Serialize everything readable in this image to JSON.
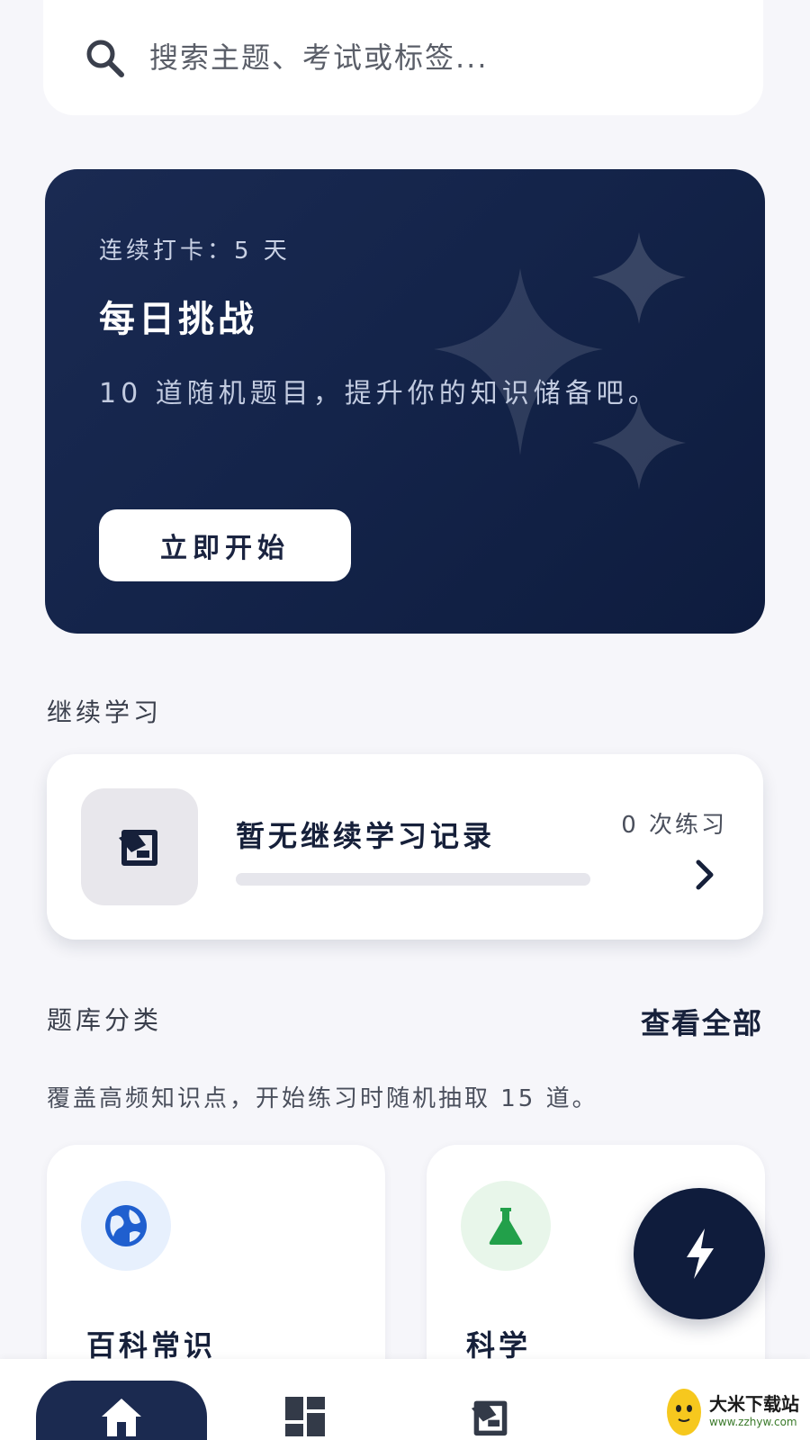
{
  "search": {
    "placeholder": "搜索主题、考试或标签..."
  },
  "daily": {
    "streak": "连续打卡：5 天",
    "title": "每日挑战",
    "description": "10 道随机题目，提升你的知识储备吧。",
    "start_label": "立即开始",
    "colors": {
      "background": "#14244a",
      "button": "#ffffff"
    }
  },
  "continue_section": {
    "label": "继续学习",
    "record_title": "暂无继续学习记录",
    "practice_count": "0 次练习",
    "progress": 0
  },
  "categories_section": {
    "label": "题库分类",
    "view_all": "查看全部",
    "description": "覆盖高频知识点，开始练习时随机抽取 15 道。",
    "items": [
      {
        "name": "百科常识",
        "icon": "globe-icon",
        "color": "#1f5fcf"
      },
      {
        "name": "科学",
        "icon": "flask-icon",
        "color": "#22a04a"
      }
    ]
  },
  "fab": {
    "icon": "lightning-icon"
  },
  "bottom_nav": {
    "items": [
      {
        "icon": "home-icon",
        "active": true
      },
      {
        "icon": "dashboard-icon",
        "active": false
      },
      {
        "icon": "practice-icon",
        "active": false
      }
    ]
  },
  "watermark": {
    "name": "大米下载站",
    "url": "www.zzhyw.com"
  }
}
